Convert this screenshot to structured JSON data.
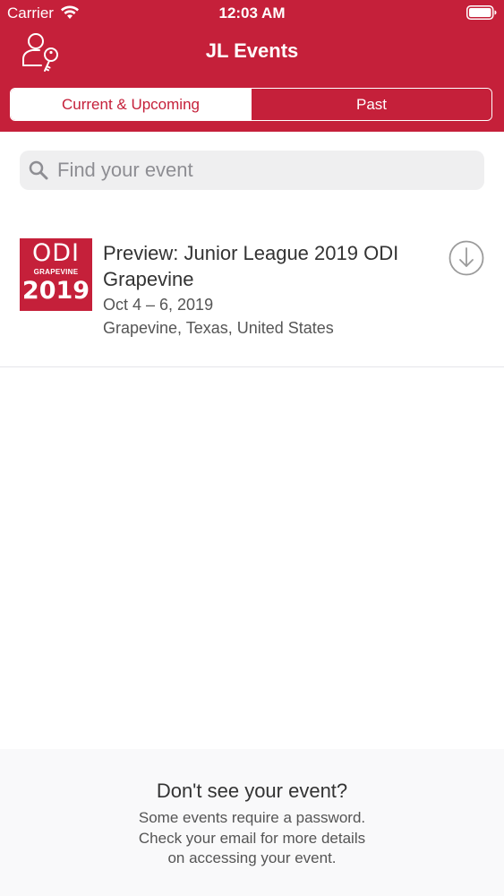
{
  "status_bar": {
    "carrier": "Carrier",
    "time": "12:03 AM"
  },
  "nav": {
    "title": "JL Events",
    "left_icon": "login-key-icon"
  },
  "segments": {
    "current_label": "Current & Upcoming",
    "past_label": "Past",
    "selected": "Current & Upcoming"
  },
  "search": {
    "placeholder": "Find your event",
    "value": ""
  },
  "events": [
    {
      "thumb_line1": "ODI",
      "thumb_line2": "GRAPEVINE",
      "thumb_line3": "2019",
      "title": "Preview: Junior League 2019 ODI Grapevine",
      "dates": "Oct 4 – 6, 2019",
      "location": "Grapevine, Texas, United States",
      "action_icon": "download-icon"
    }
  ],
  "footer": {
    "title": "Don't see your event?",
    "line1": "Some events require a password.",
    "line2": "Check your email for more details",
    "line3": "on accessing your event."
  },
  "colors": {
    "brand": "#c5203a",
    "search_bg": "#efeff0",
    "footer_bg": "#f9f9fa"
  }
}
